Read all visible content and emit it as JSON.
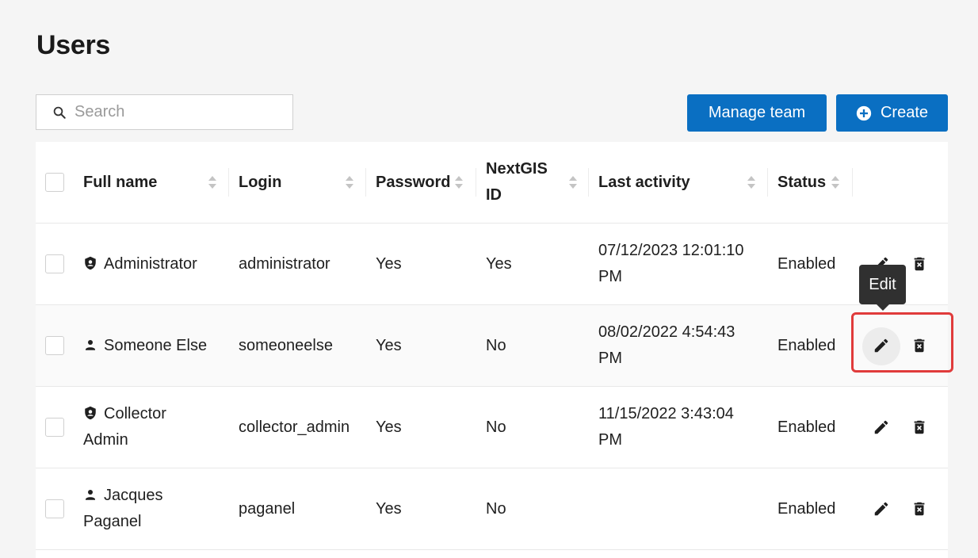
{
  "page": {
    "title": "Users"
  },
  "search": {
    "placeholder": "Search",
    "value": ""
  },
  "toolbar": {
    "manage_team_label": "Manage team",
    "create_label": "Create"
  },
  "table": {
    "columns": [
      {
        "key": "full_name",
        "label": "Full name"
      },
      {
        "key": "login",
        "label": "Login"
      },
      {
        "key": "password",
        "label": "Password"
      },
      {
        "key": "nextgis_id",
        "label": "NextGIS ID"
      },
      {
        "key": "last_activity",
        "label": "Last activity"
      },
      {
        "key": "status",
        "label": "Status"
      }
    ],
    "rows": [
      {
        "icon": "shield-user-icon",
        "full_name": "Administrator",
        "login": "administrator",
        "password": "Yes",
        "nextgis_id": "Yes",
        "last_activity": "07/12/2023 12:01:10 PM",
        "status": "Enabled"
      },
      {
        "icon": "person-icon",
        "full_name": "Someone Else",
        "login": "someoneelse",
        "password": "Yes",
        "nextgis_id": "No",
        "last_activity": "08/02/2022 4:54:43 PM",
        "status": "Enabled"
      },
      {
        "icon": "shield-user-icon",
        "full_name": "Collector Admin",
        "login": "collector_admin",
        "password": "Yes",
        "nextgis_id": "No",
        "last_activity": "11/15/2022 3:43:04 PM",
        "status": "Enabled"
      },
      {
        "icon": "person-icon",
        "full_name": "Jacques Paganel",
        "login": "paganel",
        "password": "Yes",
        "nextgis_id": "No",
        "last_activity": "",
        "status": "Enabled"
      }
    ]
  },
  "tooltip": {
    "text": "Edit"
  },
  "colors": {
    "primary": "#0a6fc2",
    "highlight": "#e03b3b",
    "tooltip_bg": "#303030"
  }
}
